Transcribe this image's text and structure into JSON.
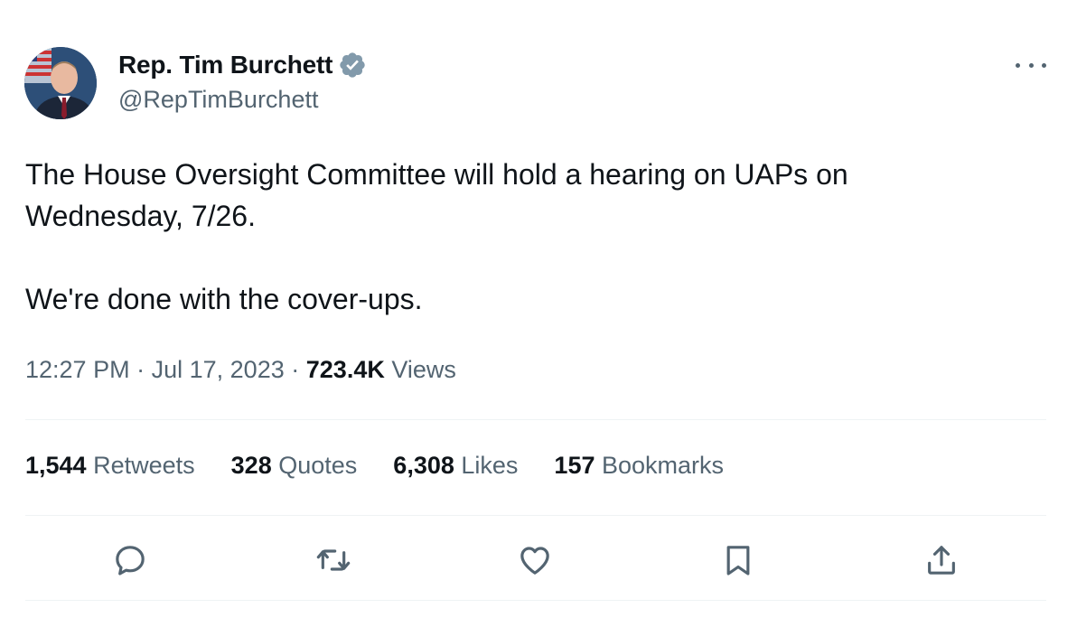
{
  "author": {
    "name": "Rep. Tim Burchett",
    "handle": "@RepTimBurchett"
  },
  "tweet": {
    "line1": "The House Oversight Committee will hold a hearing on UAPs on",
    "line2": "Wednesday, 7/26.",
    "line3": "We're done with the cover-ups."
  },
  "meta": {
    "time": "12:27 PM",
    "separator": "·",
    "date": "Jul 17, 2023",
    "views_count": "723.4K",
    "views_label": "Views"
  },
  "stats": [
    {
      "count": "1,544",
      "label": "Retweets"
    },
    {
      "count": "328",
      "label": "Quotes"
    },
    {
      "count": "6,308",
      "label": "Likes"
    },
    {
      "count": "157",
      "label": "Bookmarks"
    }
  ],
  "actions": [
    "reply-icon",
    "retweet-icon",
    "like-icon",
    "bookmark-icon",
    "share-icon"
  ],
  "colors": {
    "text": "#0f1419",
    "secondary": "#536471",
    "divider": "#eff3f4",
    "verified_badge": "#829aab"
  }
}
